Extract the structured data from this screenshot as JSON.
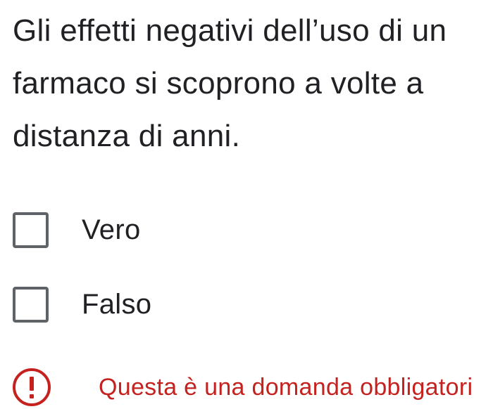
{
  "question": {
    "text": "Gli effetti negativi dell’uso di un farmaco si scoprono a volte a distanza di anni."
  },
  "options": [
    {
      "label": "Vero",
      "checked": false
    },
    {
      "label": "Falso",
      "checked": false
    }
  ],
  "error": {
    "icon": "exclamation-circle-icon",
    "text": "Questa è una domanda obbligatori",
    "color": "#c5221f"
  }
}
